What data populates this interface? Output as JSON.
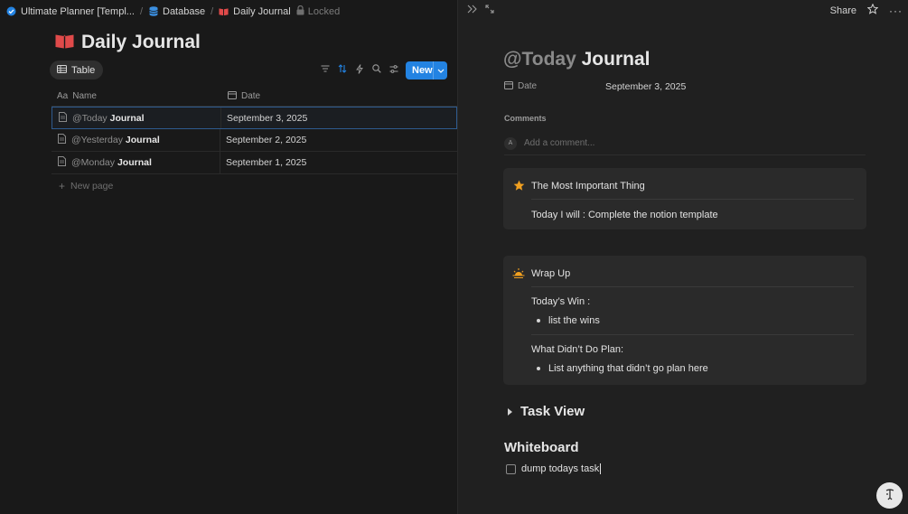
{
  "breadcrumb": {
    "items": [
      "Ultimate Planner [Templ...",
      "Database",
      "Daily Journal"
    ],
    "separator": "/",
    "locked_label": "Locked"
  },
  "page": {
    "title": "Daily Journal",
    "icon": "red-book-icon"
  },
  "view": {
    "tab_label": "Table",
    "new_button_label": "New",
    "tools": [
      "filter-icon",
      "sort-icon",
      "automation-icon",
      "search-icon",
      "settings-icon"
    ]
  },
  "table": {
    "columns": [
      {
        "label": "Name",
        "icon": "text-aa-icon"
      },
      {
        "label": "Date",
        "icon": "calendar-icon"
      }
    ],
    "rows": [
      {
        "mention": "@Today",
        "title": "Journal",
        "date": "September 3, 2025"
      },
      {
        "mention": "@Yesterday",
        "title": "Journal",
        "date": "September 2, 2025"
      },
      {
        "mention": "@Monday",
        "title": "Journal",
        "date": "September 1, 2025"
      }
    ],
    "new_page_label": "New page"
  },
  "detail": {
    "top_right": {
      "share_label": "Share"
    },
    "title_mention": "@Today",
    "title_text": "Journal",
    "date_label": "Date",
    "date_value": "September 3, 2025",
    "comments_heading": "Comments",
    "avatar_initial": "A",
    "comment_placeholder": "Add a comment...",
    "callout1": {
      "icon": "star-icon",
      "heading": "The Most Important Thing",
      "text": "Today I will : Complete the notion template"
    },
    "callout2": {
      "icon": "sunset-icon",
      "heading": "Wrap Up",
      "win_label": "Today’s Win :",
      "win_bullet": "list the wins",
      "didnt_label": "What Didn’t Do Plan:",
      "didnt_bullet": "List anything that didn’t go plan here"
    },
    "toggle_heading": "Task View",
    "whiteboard_heading": "Whiteboard",
    "todo_text": "dump todays task"
  },
  "colors": {
    "accent_blue": "#2383e2",
    "star_orange": "#f0a020",
    "book_red": "#e04a4a"
  }
}
